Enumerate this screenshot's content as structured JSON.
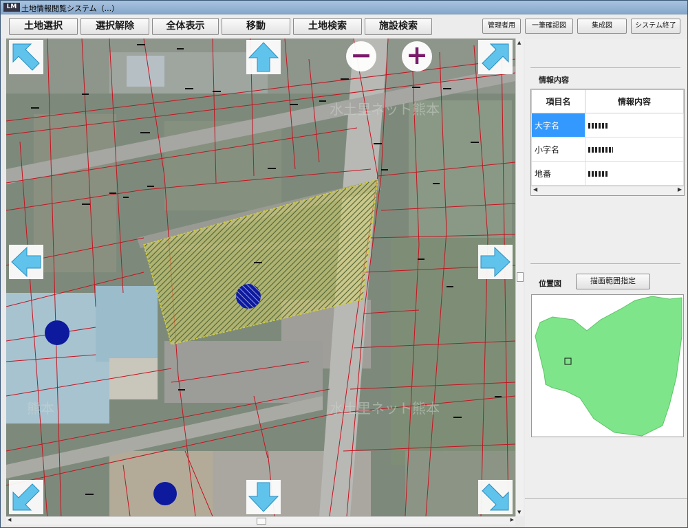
{
  "window": {
    "title": "土地情報閲覧システム（...）",
    "app_icon": "LM"
  },
  "toolbar": {
    "buttons": [
      "土地選択",
      "選択解除",
      "全体表示",
      "移動",
      "土地検索",
      "施設検索"
    ],
    "small_buttons": [
      "管理者用",
      "一筆確認図",
      "集成図",
      "システム終了"
    ]
  },
  "map": {
    "zoom_out": "−",
    "zoom_in": "+",
    "watermarks": [
      "水土里ネット熊本",
      "水土里ネット熊本",
      "熊本"
    ]
  },
  "info": {
    "section_title": "情報内容",
    "headers": [
      "項目名",
      "情報内容"
    ],
    "rows": [
      {
        "label": "大字名",
        "selected": true
      },
      {
        "label": "小字名",
        "selected": false
      },
      {
        "label": "地番",
        "selected": false
      }
    ]
  },
  "location": {
    "section_title": "位置図",
    "range_button": "描画範囲指定"
  },
  "colors": {
    "parcel_line": "#c41420",
    "selection_fill": "#e8e27a",
    "marker": "#0d1a9e",
    "arrow": "#5fc3ec",
    "minimap": "#7fe58a",
    "list_selected": "#3399ff"
  }
}
